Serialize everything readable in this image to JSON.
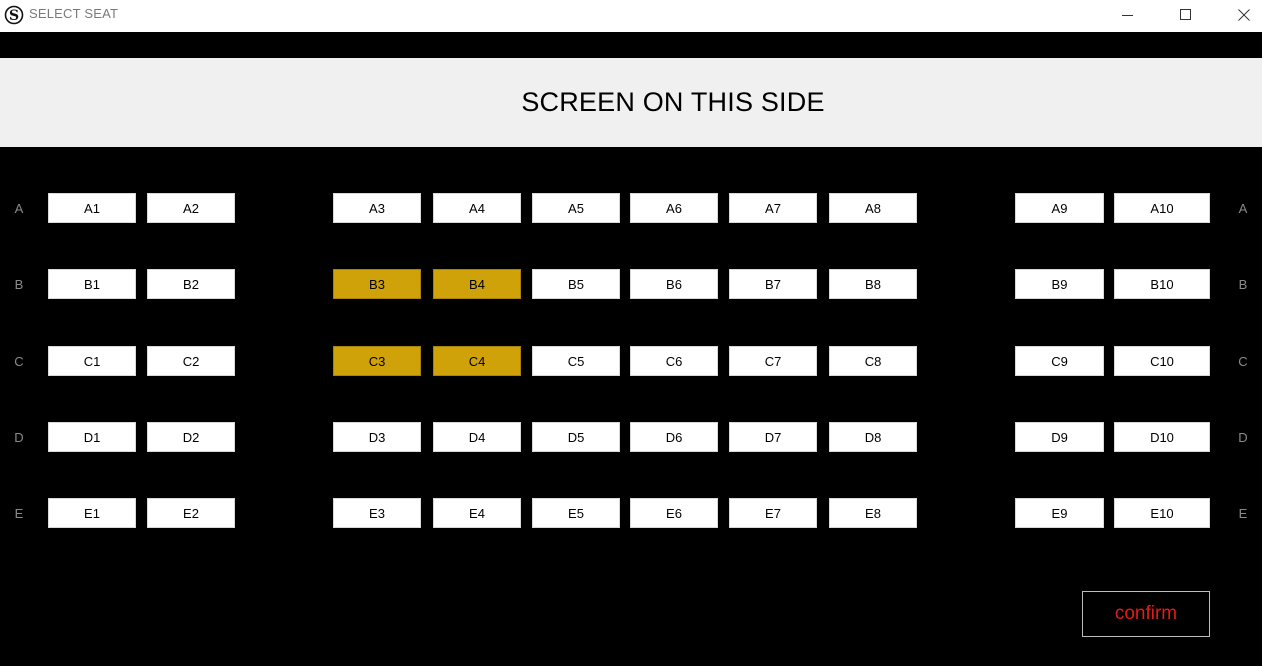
{
  "window": {
    "title": "SELECT SEAT",
    "controls": [
      "minimize",
      "maximize",
      "close"
    ]
  },
  "screen_banner": "SCREEN ON THIS SIDE",
  "rows": [
    {
      "label": "A",
      "seats": [
        "A1",
        "A2",
        "A3",
        "A4",
        "A5",
        "A6",
        "A7",
        "A8",
        "A9",
        "A10"
      ]
    },
    {
      "label": "B",
      "seats": [
        "B1",
        "B2",
        "B3",
        "B4",
        "B5",
        "B6",
        "B7",
        "B8",
        "B9",
        "B10"
      ]
    },
    {
      "label": "C",
      "seats": [
        "C1",
        "C2",
        "C3",
        "C4",
        "C5",
        "C6",
        "C7",
        "C8",
        "C9",
        "C10"
      ]
    },
    {
      "label": "D",
      "seats": [
        "D1",
        "D2",
        "D3",
        "D4",
        "D5",
        "D6",
        "D7",
        "D8",
        "D9",
        "D10"
      ]
    },
    {
      "label": "E",
      "seats": [
        "E1",
        "E2",
        "E3",
        "E4",
        "E5",
        "E6",
        "E7",
        "E8",
        "E9",
        "E10"
      ]
    }
  ],
  "selected_seats": [
    "B3",
    "B4",
    "C3",
    "C4"
  ],
  "colors": {
    "background": "#000000",
    "seat": "#ffffff",
    "selected_seat": "#cfa20a",
    "confirm_text": "#e31b1b"
  },
  "confirm_label": "confirm"
}
